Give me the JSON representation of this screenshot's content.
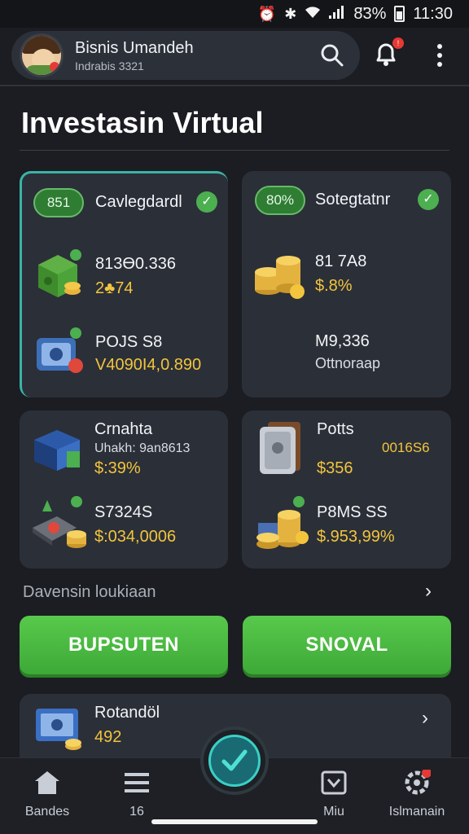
{
  "status_bar": {
    "battery_text": "8̈3%",
    "time": "11:30"
  },
  "header": {
    "user_name": "Bisnis Umandeh",
    "user_sub": "Indrabis 3321"
  },
  "page": {
    "title": "Investasin Virtual"
  },
  "cards": [
    {
      "badge": "851",
      "title": "Cavlegdardl",
      "row1_value": "813Ө0.336",
      "row1_sub": "2♣74",
      "row2_value": "POJS S8",
      "row2_sub": "V4090I4,0.890"
    },
    {
      "badge": "80%",
      "title": "Sotegtatnr",
      "row1_value": "81 7A8",
      "row1_sub": "$.8%",
      "row2_value": "M9,336",
      "row2_sub": "Ottnoraap"
    },
    {
      "title": "Crnahta",
      "subtitle": "Uhakh: 9an8613",
      "row1_sub": "$:39%",
      "row2_value": "S7324S",
      "row2_sub": "$:034,0006"
    },
    {
      "title": "Potts",
      "side_value": "0016S6",
      "row1_sub": "$356",
      "row2_value": "P8MS SS",
      "row2_sub": "$.953,99%"
    }
  ],
  "section": {
    "link_label": "Davensin loukiaan"
  },
  "actions": {
    "primary": "BUPSUTEN",
    "secondary": "SNOVAL"
  },
  "bottom_card": {
    "title": "Rotandöl",
    "value": "492"
  },
  "nav": {
    "items": [
      {
        "label": "Bandes"
      },
      {
        "label": "16"
      },
      {
        "label": "Miu"
      },
      {
        "label": "Islmanain"
      }
    ]
  },
  "colors": {
    "accent_green": "#4caf50",
    "gold_text": "#f2c53d",
    "teal": "#3ad0c6"
  }
}
